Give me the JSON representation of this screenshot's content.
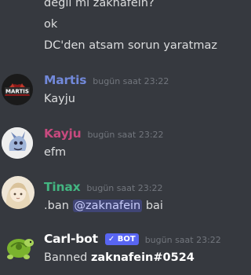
{
  "continued_lines": [
    "değil mi zaknafein?",
    "ok",
    "DC'den atsam sorun yaratmaz"
  ],
  "messages": [
    {
      "username": "Martis",
      "username_color": "#7289da",
      "timestamp": "bugün saat 23:22",
      "text": "Kayju",
      "avatar_icon": "martis-logo-avatar",
      "avatar_text": "MARTIS"
    },
    {
      "username": "Kayju",
      "username_color": "#c84a7f",
      "timestamp": "bugün saat 23:22",
      "text": "efm",
      "avatar_icon": "dragon-avatar"
    },
    {
      "username": "Tinax",
      "username_color": "#43b581",
      "timestamp": "bugün saat 23:22",
      "text_prefix": ".ban",
      "mention": "@zaknafein",
      "text_suffix": "bai",
      "avatar_icon": "anime-girl-avatar"
    },
    {
      "username": "Carl-bot",
      "username_color": "#ffffff",
      "badge": "BOT",
      "badge_check": "✓",
      "timestamp": "bugün saat 23:22",
      "text_prefix": "Banned",
      "bold_text": "zaknafein#0524",
      "avatar_icon": "turtle-avatar"
    }
  ],
  "colors": {
    "background": "#36393f",
    "text": "#dcddde",
    "timestamp": "#72767d",
    "mention_bg": "#5865f2",
    "bot_badge": "#5865f2"
  }
}
